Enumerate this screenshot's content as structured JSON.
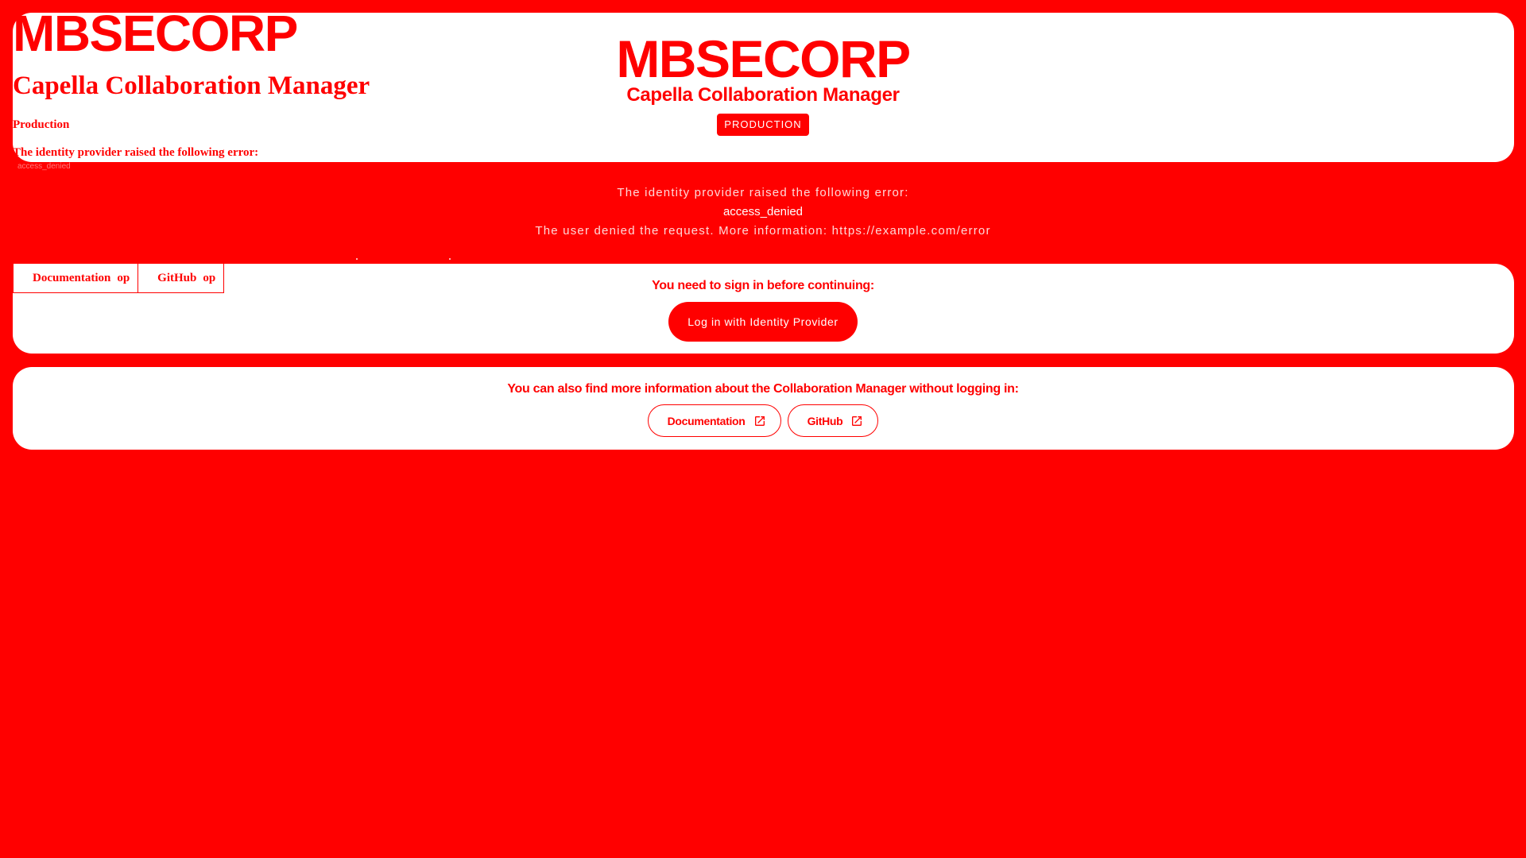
{
  "brand": {
    "logo_text": "MBSECORP",
    "app_title": "Capella Collaboration Manager",
    "environment_raw": "Production",
    "environment_badge": "PRODUCTION"
  },
  "error": {
    "raw_heading": "The identity provider raised the following error:",
    "title": "The identity provider raised the following error:",
    "code": "access_denied",
    "detail": "The user denied the request. More information: https://example.com/error"
  },
  "login": {
    "message": "You need to sign in before continuing:",
    "button_label": "Log in with Identity Provider"
  },
  "info": {
    "message": "You can also find more information about the Collaboration Manager without logging in:",
    "links": [
      {
        "label": "Documentation",
        "icon": "open-in-new-icon"
      },
      {
        "label": "GitHub",
        "icon": "open-in-new-icon"
      }
    ],
    "raw_icon_glyph": "op"
  },
  "colors": {
    "accent": "#ff0000",
    "surface": "#ffffff"
  }
}
